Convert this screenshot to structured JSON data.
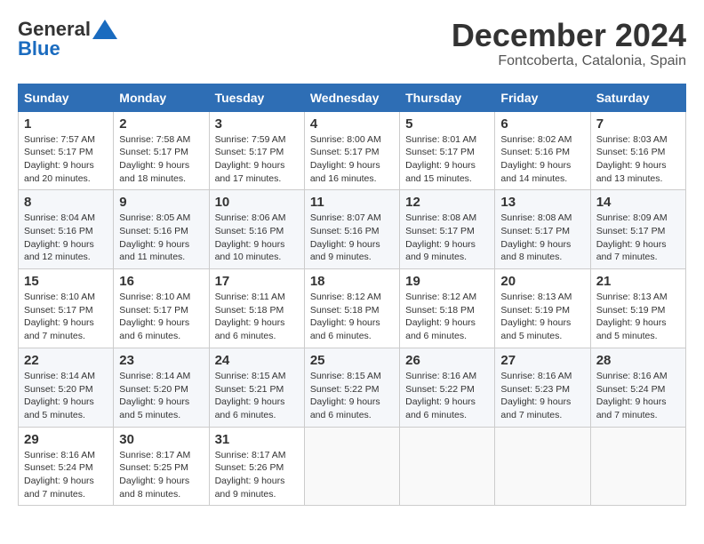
{
  "logo": {
    "general": "General",
    "blue": "Blue"
  },
  "title": "December 2024",
  "subtitle": "Fontcoberta, Catalonia, Spain",
  "days_of_week": [
    "Sunday",
    "Monday",
    "Tuesday",
    "Wednesday",
    "Thursday",
    "Friday",
    "Saturday"
  ],
  "weeks": [
    [
      {
        "day": "1",
        "sunrise": "Sunrise: 7:57 AM",
        "sunset": "Sunset: 5:17 PM",
        "daylight": "Daylight: 9 hours and 20 minutes."
      },
      {
        "day": "2",
        "sunrise": "Sunrise: 7:58 AM",
        "sunset": "Sunset: 5:17 PM",
        "daylight": "Daylight: 9 hours and 18 minutes."
      },
      {
        "day": "3",
        "sunrise": "Sunrise: 7:59 AM",
        "sunset": "Sunset: 5:17 PM",
        "daylight": "Daylight: 9 hours and 17 minutes."
      },
      {
        "day": "4",
        "sunrise": "Sunrise: 8:00 AM",
        "sunset": "Sunset: 5:17 PM",
        "daylight": "Daylight: 9 hours and 16 minutes."
      },
      {
        "day": "5",
        "sunrise": "Sunrise: 8:01 AM",
        "sunset": "Sunset: 5:17 PM",
        "daylight": "Daylight: 9 hours and 15 minutes."
      },
      {
        "day": "6",
        "sunrise": "Sunrise: 8:02 AM",
        "sunset": "Sunset: 5:16 PM",
        "daylight": "Daylight: 9 hours and 14 minutes."
      },
      {
        "day": "7",
        "sunrise": "Sunrise: 8:03 AM",
        "sunset": "Sunset: 5:16 PM",
        "daylight": "Daylight: 9 hours and 13 minutes."
      }
    ],
    [
      {
        "day": "8",
        "sunrise": "Sunrise: 8:04 AM",
        "sunset": "Sunset: 5:16 PM",
        "daylight": "Daylight: 9 hours and 12 minutes."
      },
      {
        "day": "9",
        "sunrise": "Sunrise: 8:05 AM",
        "sunset": "Sunset: 5:16 PM",
        "daylight": "Daylight: 9 hours and 11 minutes."
      },
      {
        "day": "10",
        "sunrise": "Sunrise: 8:06 AM",
        "sunset": "Sunset: 5:16 PM",
        "daylight": "Daylight: 9 hours and 10 minutes."
      },
      {
        "day": "11",
        "sunrise": "Sunrise: 8:07 AM",
        "sunset": "Sunset: 5:16 PM",
        "daylight": "Daylight: 9 hours and 9 minutes."
      },
      {
        "day": "12",
        "sunrise": "Sunrise: 8:08 AM",
        "sunset": "Sunset: 5:17 PM",
        "daylight": "Daylight: 9 hours and 9 minutes."
      },
      {
        "day": "13",
        "sunrise": "Sunrise: 8:08 AM",
        "sunset": "Sunset: 5:17 PM",
        "daylight": "Daylight: 9 hours and 8 minutes."
      },
      {
        "day": "14",
        "sunrise": "Sunrise: 8:09 AM",
        "sunset": "Sunset: 5:17 PM",
        "daylight": "Daylight: 9 hours and 7 minutes."
      }
    ],
    [
      {
        "day": "15",
        "sunrise": "Sunrise: 8:10 AM",
        "sunset": "Sunset: 5:17 PM",
        "daylight": "Daylight: 9 hours and 7 minutes."
      },
      {
        "day": "16",
        "sunrise": "Sunrise: 8:10 AM",
        "sunset": "Sunset: 5:17 PM",
        "daylight": "Daylight: 9 hours and 6 minutes."
      },
      {
        "day": "17",
        "sunrise": "Sunrise: 8:11 AM",
        "sunset": "Sunset: 5:18 PM",
        "daylight": "Daylight: 9 hours and 6 minutes."
      },
      {
        "day": "18",
        "sunrise": "Sunrise: 8:12 AM",
        "sunset": "Sunset: 5:18 PM",
        "daylight": "Daylight: 9 hours and 6 minutes."
      },
      {
        "day": "19",
        "sunrise": "Sunrise: 8:12 AM",
        "sunset": "Sunset: 5:18 PM",
        "daylight": "Daylight: 9 hours and 6 minutes."
      },
      {
        "day": "20",
        "sunrise": "Sunrise: 8:13 AM",
        "sunset": "Sunset: 5:19 PM",
        "daylight": "Daylight: 9 hours and 5 minutes."
      },
      {
        "day": "21",
        "sunrise": "Sunrise: 8:13 AM",
        "sunset": "Sunset: 5:19 PM",
        "daylight": "Daylight: 9 hours and 5 minutes."
      }
    ],
    [
      {
        "day": "22",
        "sunrise": "Sunrise: 8:14 AM",
        "sunset": "Sunset: 5:20 PM",
        "daylight": "Daylight: 9 hours and 5 minutes."
      },
      {
        "day": "23",
        "sunrise": "Sunrise: 8:14 AM",
        "sunset": "Sunset: 5:20 PM",
        "daylight": "Daylight: 9 hours and 5 minutes."
      },
      {
        "day": "24",
        "sunrise": "Sunrise: 8:15 AM",
        "sunset": "Sunset: 5:21 PM",
        "daylight": "Daylight: 9 hours and 6 minutes."
      },
      {
        "day": "25",
        "sunrise": "Sunrise: 8:15 AM",
        "sunset": "Sunset: 5:22 PM",
        "daylight": "Daylight: 9 hours and 6 minutes."
      },
      {
        "day": "26",
        "sunrise": "Sunrise: 8:16 AM",
        "sunset": "Sunset: 5:22 PM",
        "daylight": "Daylight: 9 hours and 6 minutes."
      },
      {
        "day": "27",
        "sunrise": "Sunrise: 8:16 AM",
        "sunset": "Sunset: 5:23 PM",
        "daylight": "Daylight: 9 hours and 7 minutes."
      },
      {
        "day": "28",
        "sunrise": "Sunrise: 8:16 AM",
        "sunset": "Sunset: 5:24 PM",
        "daylight": "Daylight: 9 hours and 7 minutes."
      }
    ],
    [
      {
        "day": "29",
        "sunrise": "Sunrise: 8:16 AM",
        "sunset": "Sunset: 5:24 PM",
        "daylight": "Daylight: 9 hours and 7 minutes."
      },
      {
        "day": "30",
        "sunrise": "Sunrise: 8:17 AM",
        "sunset": "Sunset: 5:25 PM",
        "daylight": "Daylight: 9 hours and 8 minutes."
      },
      {
        "day": "31",
        "sunrise": "Sunrise: 8:17 AM",
        "sunset": "Sunset: 5:26 PM",
        "daylight": "Daylight: 9 hours and 9 minutes."
      },
      null,
      null,
      null,
      null
    ]
  ]
}
